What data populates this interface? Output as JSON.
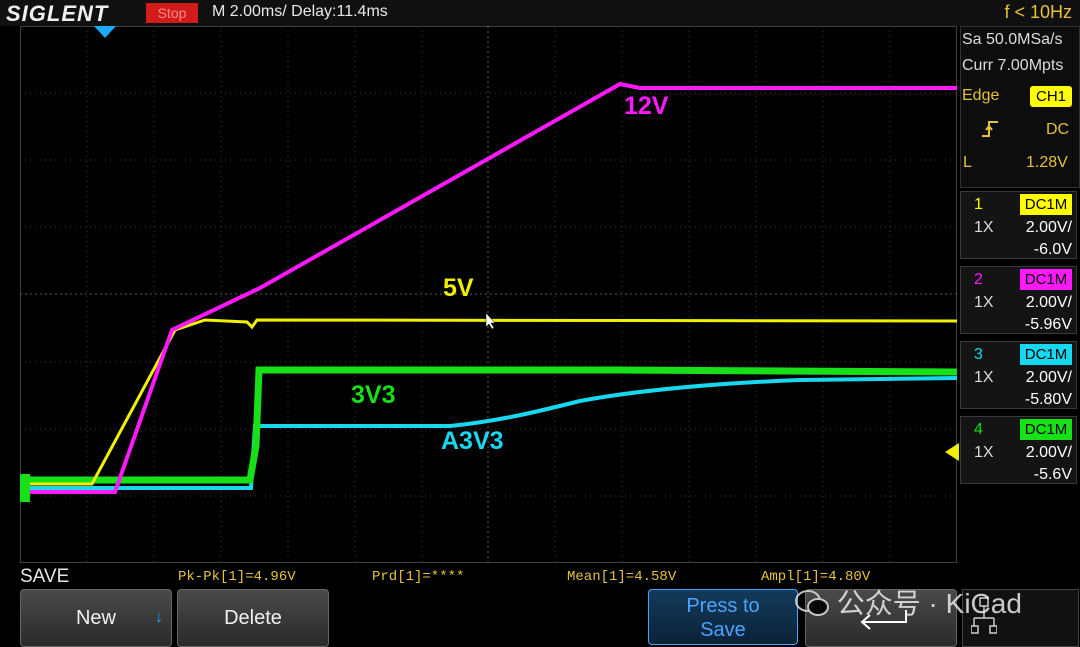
{
  "header": {
    "logo": "SIGLENT",
    "run_state": "Stop",
    "timebase": "M 2.00ms/ Delay:11.4ms",
    "frequency": "f < 10Hz"
  },
  "acquisition": {
    "sample_rate": "Sa 50.0MSa/s",
    "memory_depth": "Curr 7.00Mpts"
  },
  "trigger": {
    "type": "Edge",
    "source": "CH1",
    "coupling": "DC",
    "level_label": "L",
    "level": "1.28V"
  },
  "channels": [
    {
      "num": "1",
      "coupling": "DC1M",
      "probe": "1X",
      "scale": "2.00V/",
      "offset": "-6.0V",
      "color": "#ffff00"
    },
    {
      "num": "2",
      "coupling": "DC1M",
      "probe": "1X",
      "scale": "2.00V/",
      "offset": "-5.96V",
      "color": "#ff19ff"
    },
    {
      "num": "3",
      "coupling": "DC1M",
      "probe": "1X",
      "scale": "2.00V/",
      "offset": "-5.80V",
      "color": "#18d8f0"
    },
    {
      "num": "4",
      "coupling": "DC1M",
      "probe": "1X",
      "scale": "2.00V/",
      "offset": "-5.6V",
      "color": "#18e018"
    }
  ],
  "trace_labels": {
    "ch2": "12V",
    "ch1": "5V",
    "ch4": "3V3",
    "ch3": "A3V3"
  },
  "measurements": {
    "menu_title": "SAVE",
    "pkpk": "Pk-Pk[1]=4.96V",
    "prd": "Prd[1]=****",
    "mean": "Mean[1]=4.58V",
    "ampl": "Ampl[1]=4.80V"
  },
  "softkeys": {
    "new": "New",
    "delete": "Delete",
    "press_to": "Press to",
    "save": "Save"
  },
  "watermark": "公众号 · KiCad"
}
